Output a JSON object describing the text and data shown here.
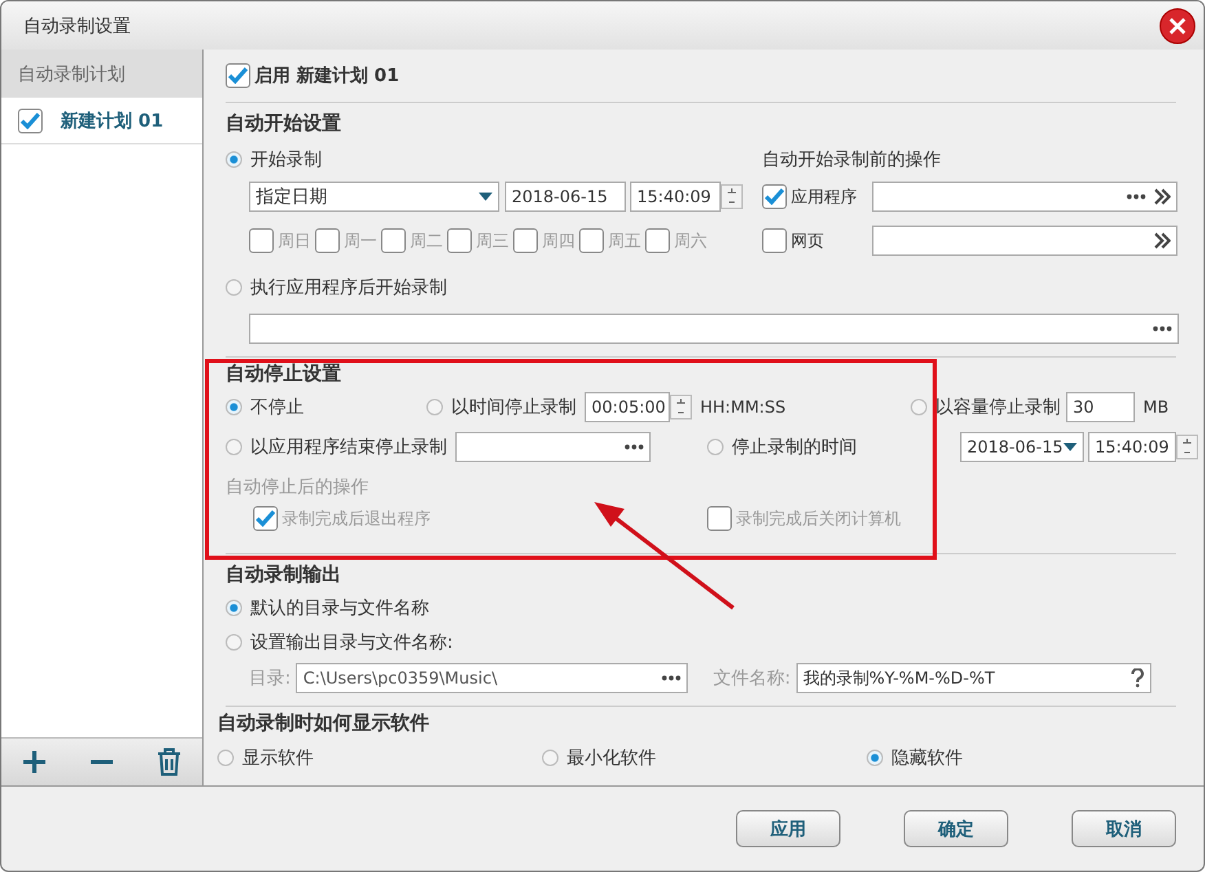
{
  "window": {
    "title": "自动录制设置"
  },
  "sidebar": {
    "header": "自动录制计划",
    "items": [
      {
        "label": "新建计划 01",
        "checked": true,
        "selected": true
      }
    ]
  },
  "enable": {
    "label": "启用 新建计划 01",
    "checked": true
  },
  "auto_start": {
    "title": "自动开始设置",
    "options": [
      {
        "label": "开始录制",
        "selected": true
      },
      {
        "label": "执行应用程序后开始录制",
        "selected": false
      }
    ],
    "mode": "指定日期",
    "date": "2018-06-15",
    "time": "15:40:09",
    "weekdays": [
      {
        "label": "周日",
        "checked": false
      },
      {
        "label": "周一",
        "checked": false
      },
      {
        "label": "周二",
        "checked": false
      },
      {
        "label": "周三",
        "checked": false
      },
      {
        "label": "周四",
        "checked": false
      },
      {
        "label": "周五",
        "checked": false
      },
      {
        "label": "周六",
        "checked": false
      }
    ],
    "pre_actions": {
      "title": "自动开始录制前的操作",
      "items": [
        {
          "label": "应用程序",
          "checked": true,
          "kind": "browse"
        },
        {
          "label": "网页",
          "checked": false,
          "kind": "plain"
        }
      ]
    }
  },
  "auto_stop": {
    "title": "自动停止设置",
    "options": [
      {
        "label": "不停止",
        "selected": true,
        "kind": "plain"
      },
      {
        "label": "以时间停止录制",
        "selected": false,
        "kind": "time",
        "value": "00:05:00",
        "unit": "HH:MM:SS"
      },
      {
        "label": "以容量停止录制",
        "selected": false,
        "kind": "size",
        "value": "30",
        "unit": "MB"
      },
      {
        "label": "以应用程序结束停止录制",
        "selected": false,
        "kind": "app"
      },
      {
        "label": "停止录制的时间",
        "selected": false,
        "kind": "datetime",
        "date": "2018-06-15",
        "time": "15:40:09"
      }
    ],
    "after_title": "自动停止后的操作",
    "after_actions": [
      {
        "label": "录制完成后退出程序",
        "checked": true
      },
      {
        "label": "录制完成后关闭计算机",
        "checked": false
      }
    ]
  },
  "output": {
    "title": "自动录制输出",
    "options": [
      {
        "label": "默认的目录与文件名称",
        "selected": true
      },
      {
        "label": "设置输出目录与文件名称:",
        "selected": false
      }
    ],
    "dir_label": "目录:",
    "dir_value": "C:\\Users\\pc0359\\Music\\",
    "name_label": "文件名称:",
    "name_value": "我的录制%Y-%M-%D-%T"
  },
  "display": {
    "title": "自动录制时如何显示软件",
    "options": [
      {
        "label": "显示软件",
        "selected": false
      },
      {
        "label": "最小化软件",
        "selected": false
      },
      {
        "label": "隐藏软件",
        "selected": true
      }
    ]
  },
  "buttons": [
    "应用",
    "确定",
    "取消"
  ]
}
